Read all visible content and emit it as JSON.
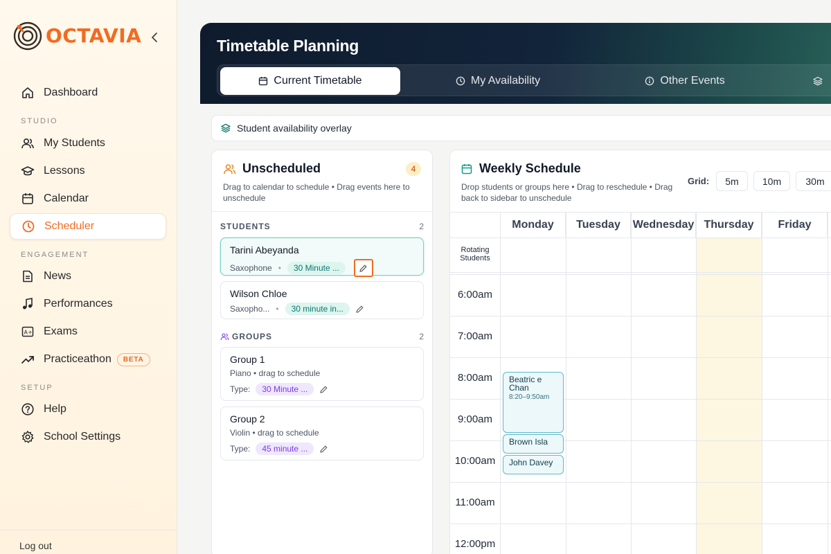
{
  "brand": {
    "name": "OCTAVIA",
    "accent": "#f26b21"
  },
  "sidebar": {
    "items_top": [
      {
        "label": "Dashboard",
        "icon": "home-icon"
      }
    ],
    "sections": [
      {
        "label": "STUDIO",
        "items": [
          {
            "label": "My Students",
            "icon": "users-icon"
          },
          {
            "label": "Lessons",
            "icon": "graduation-cap-icon"
          },
          {
            "label": "Calendar",
            "icon": "calendar-icon"
          },
          {
            "label": "Scheduler",
            "icon": "clock-icon",
            "active": true
          }
        ]
      },
      {
        "label": "ENGAGEMENT",
        "items": [
          {
            "label": "News",
            "icon": "newspaper-icon"
          },
          {
            "label": "Performances",
            "icon": "music-note-icon"
          },
          {
            "label": "Exams",
            "icon": "exam-grade-icon"
          },
          {
            "label": "Practiceathon",
            "icon": "trending-up-icon",
            "badge": "BETA"
          }
        ]
      },
      {
        "label": "SETUP",
        "items": [
          {
            "label": "Help",
            "icon": "help-circle-icon"
          },
          {
            "label": "School Settings",
            "icon": "settings-gear-icon"
          }
        ]
      }
    ],
    "logout": "Log out"
  },
  "header": {
    "title": "Timetable Planning",
    "tabs": [
      {
        "label": "Current Timetable",
        "icon": "calendar-icon",
        "active": true
      },
      {
        "label": "My Availability",
        "icon": "clock-icon"
      },
      {
        "label": "Other Events",
        "icon": "info-icon"
      },
      {
        "label": "",
        "icon": "layers-icon"
      }
    ]
  },
  "overlay": {
    "label": "Student availability overlay",
    "icon": "layers-icon"
  },
  "unscheduled": {
    "title": "Unscheduled",
    "count": "4",
    "subtitle": "Drag to calendar to schedule • Drag events here to unschedule",
    "students_label": "STUDENTS",
    "students_count": "2",
    "students": [
      {
        "name": "Tarini Abeyanda",
        "instrument": "Saxophone",
        "duration": "30 Minute ...",
        "selected": true
      },
      {
        "name": "Wilson Chloe",
        "instrument": "Saxopho...",
        "duration": "30 minute in..."
      }
    ],
    "groups_label": "GROUPS",
    "groups_count": "2",
    "groups": [
      {
        "name": "Group 1",
        "detail": "Piano • drag to schedule",
        "type_label": "Type:",
        "type": "30 Minute ..."
      },
      {
        "name": "Group 2",
        "detail": "Violin • drag to schedule",
        "type_label": "Type:",
        "type": "45 minute ..."
      }
    ]
  },
  "weekly": {
    "title": "Weekly Schedule",
    "subtitle": "Drop students or groups here • Drag to reschedule • Drag back to sidebar to unschedule",
    "grid_label": "Grid:",
    "grid_options": [
      "5m",
      "10m",
      "30m"
    ],
    "days": [
      "Monday",
      "Tuesday",
      "Wednesday",
      "Thursday",
      "Friday"
    ],
    "highlight_day": "Thursday",
    "rotating_label": "Rotating Students",
    "times": [
      "6:00am",
      "7:00am",
      "8:00am",
      "9:00am",
      "10:00am",
      "11:00am",
      "12:00pm"
    ],
    "events": [
      {
        "name": "Beatric e Chan",
        "time": "8:20–9:50am",
        "day": "Monday"
      },
      {
        "name": "Brown Isla",
        "day": "Monday"
      },
      {
        "name": "John Davey",
        "day": "Monday"
      }
    ]
  }
}
